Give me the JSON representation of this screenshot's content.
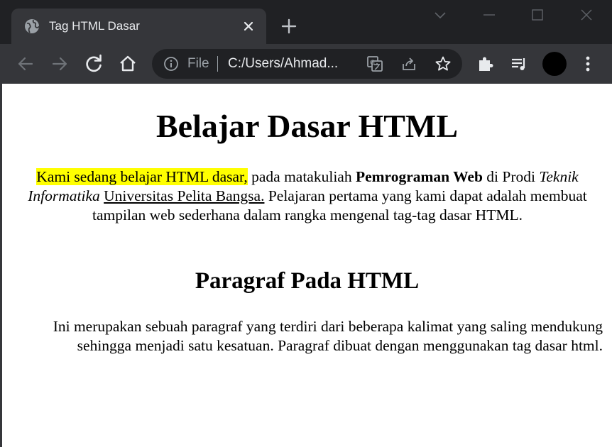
{
  "browser": {
    "tab": {
      "title": "Tag HTML Dasar",
      "icon": "globe-icon"
    },
    "address_bar": {
      "scheme_label": "File",
      "url": "C:/Users/Ahmad..."
    },
    "colors": {
      "frame": "#202124",
      "toolbar": "#35363a",
      "text": "#e8eaed",
      "muted": "#9aa0a6"
    }
  },
  "page": {
    "heading": "Belajar Dasar HTML",
    "paragraph1": {
      "highlighted": "Kami sedang belajar HTML dasar,",
      "text1": " pada matakuliah ",
      "bold": "Pemrograman Web",
      "text2": " di Prodi ",
      "italic": "Teknik Informatika",
      "text3": " ",
      "underline": "Universitas Pelita Bangsa.",
      "text4": " Pelajaran pertama yang kami dapat adalah membuat tampilan web sederhana dalam rangka mengenal tag-tag dasar HTML."
    },
    "subheading": "Paragraf Pada HTML",
    "paragraph2": "Ini merupakan sebuah paragraf yang terdiri dari beberapa kalimat yang saling mendukung sehingga menjadi satu kesatuan. Paragraf dibuat dengan menggunakan tag dasar html.",
    "colors": {
      "highlight": "#ffff00",
      "background": "#ffffff"
    }
  }
}
